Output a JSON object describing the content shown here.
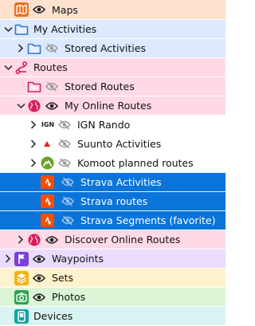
{
  "colors": {
    "maps_bg": "#ffe1cf",
    "activities_bg": "#dce9ff",
    "routes_bg": "#ffd9e6",
    "waypoints_bg": "#eadcff",
    "sets_bg": "#fff2cc",
    "photos_bg": "#dcf5d6",
    "devices_bg": "#d8f3f2",
    "selection": "#0a74d9"
  },
  "tree": {
    "maps": {
      "label": "Maps",
      "icon": "map-icon"
    },
    "my_activities": {
      "label": "My Activities",
      "icon": "folder-icon"
    },
    "stored_activities": {
      "label": "Stored Activities",
      "icon": "folder-icon"
    },
    "routes": {
      "label": "Routes",
      "icon": "route-icon"
    },
    "stored_routes": {
      "label": "Stored Routes",
      "icon": "folder-icon"
    },
    "my_online_routes": {
      "label": "My Online Routes",
      "icon": "globe-icon"
    },
    "ign_rando": {
      "label": "IGN Rando",
      "icon_text": "IGN"
    },
    "suunto_activities": {
      "label": "Suunto Activities",
      "icon": "suunto-icon"
    },
    "komoot_routes": {
      "label": "Komoot planned routes",
      "icon": "komoot-icon"
    },
    "strava_activities": {
      "label": "Strava Activities",
      "icon": "strava-icon"
    },
    "strava_routes": {
      "label": "Strava routes",
      "icon": "strava-icon"
    },
    "strava_segments": {
      "label": "Strava Segments (favorite)",
      "icon": "strava-icon"
    },
    "discover_online_routes": {
      "label": "Discover Online Routes",
      "icon": "globe-icon"
    },
    "waypoints": {
      "label": "Waypoints",
      "icon": "waypoint-flag-icon"
    },
    "sets": {
      "label": "Sets",
      "icon": "sets-icon"
    },
    "photos": {
      "label": "Photos",
      "icon": "camera-icon"
    },
    "devices": {
      "label": "Devices",
      "icon": "device-icon"
    }
  }
}
